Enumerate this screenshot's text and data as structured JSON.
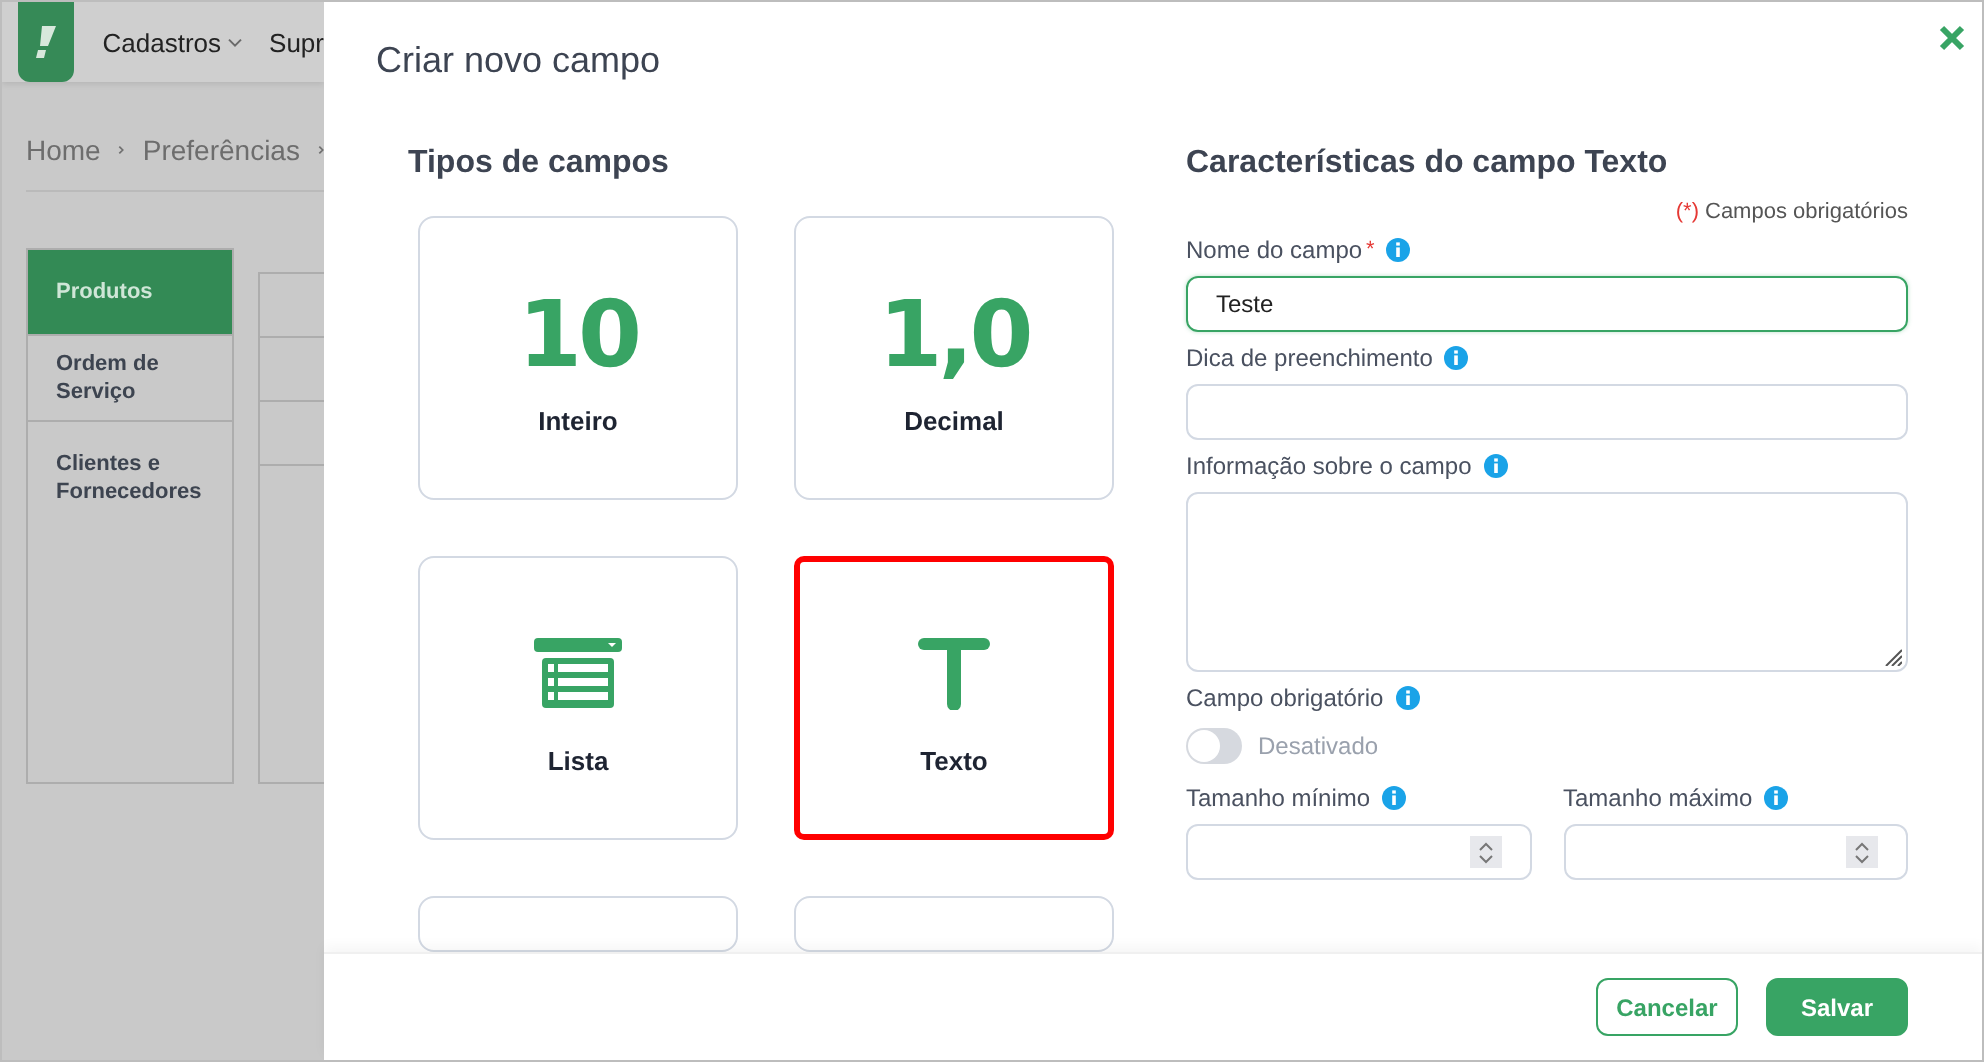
{
  "app": {
    "menu": [
      {
        "label": "Cadastros",
        "has_caret": true
      },
      {
        "label": "Supr",
        "has_caret": false
      }
    ],
    "breadcrumb": [
      "Home",
      "Preferências"
    ],
    "sidebar": [
      {
        "label": "Produtos",
        "selected": true
      },
      {
        "label": "Ordem de Serviço",
        "selected": false
      },
      {
        "label": "Clientes e Fornecedores",
        "selected": false
      }
    ]
  },
  "modal": {
    "title": "Criar novo campo",
    "types_title": "Tipos de campos",
    "field_types": [
      {
        "kind": "number",
        "glyph": "10",
        "label": "Inteiro",
        "selected": false
      },
      {
        "kind": "number",
        "glyph": "1,0",
        "label": "Decimal",
        "selected": false
      },
      {
        "kind": "list",
        "label": "Lista",
        "selected": false
      },
      {
        "kind": "text",
        "label": "Texto",
        "selected": true
      },
      {
        "kind": "cut"
      },
      {
        "kind": "cut"
      }
    ],
    "form_title": "Características do campo Texto",
    "required_mark": "(*)",
    "required_note": "Campos obrigatórios",
    "fields": [
      {
        "kind": "text",
        "label": "Nome do campo",
        "required_mark": "*",
        "value": "Teste",
        "focused": true
      },
      {
        "kind": "text",
        "label": "Dica de preenchimento",
        "focused": false
      },
      {
        "kind": "textarea",
        "label": "Informação sobre o campo"
      },
      {
        "kind": "toggle",
        "label": "Campo obrigatório",
        "on": false,
        "state_text": "Desativado"
      }
    ],
    "size_fields": [
      {
        "label": "Tamanho mínimo"
      },
      {
        "label": "Tamanho máximo"
      }
    ],
    "buttons": [
      {
        "kind": "secondary",
        "label": "Cancelar"
      },
      {
        "kind": "primary",
        "label": "Salvar"
      }
    ]
  }
}
